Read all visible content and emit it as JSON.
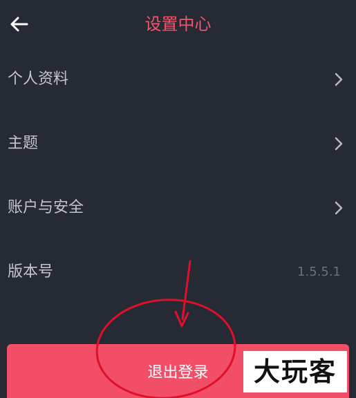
{
  "header": {
    "back_icon": "arrow-left-icon",
    "title": "设置中心",
    "title_color": "#f0566e"
  },
  "menu": {
    "items": [
      {
        "label": "个人资料",
        "icon": "chevron-right-icon"
      },
      {
        "label": "主题",
        "icon": "chevron-right-icon"
      },
      {
        "label": "账户与安全",
        "icon": "chevron-right-icon"
      },
      {
        "label": "版本号",
        "value": "1.5.5.1"
      }
    ]
  },
  "logout": {
    "label": "退出登录",
    "color": "#f24e68"
  },
  "annotation": {
    "arrow_color": "#e0102a",
    "circle_color": "#e0102a"
  },
  "watermark": {
    "text": "大玩客"
  }
}
